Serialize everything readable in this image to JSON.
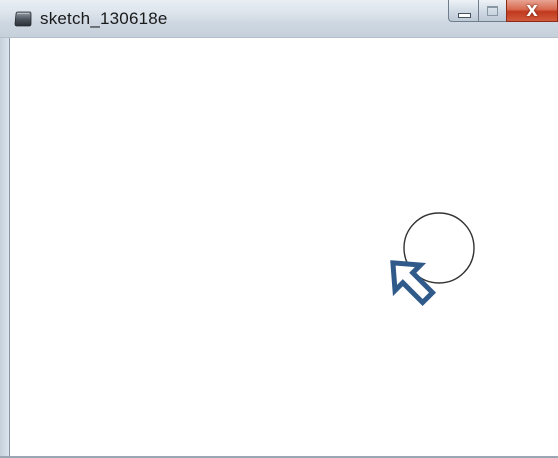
{
  "window": {
    "title": "sketch_130618e",
    "icon": "processing-sketch-icon",
    "buttons": {
      "minimize_icon": "minimize-icon",
      "maximize_icon": "maximize-icon",
      "close_label": "X"
    }
  },
  "canvas": {
    "background": "#ffffff",
    "shapes": [
      {
        "type": "circle",
        "stroke": "#333333",
        "fill": "none"
      }
    ],
    "cursor": {
      "icon": "arrow-cursor-icon",
      "color": "#2f5a8a"
    }
  }
}
